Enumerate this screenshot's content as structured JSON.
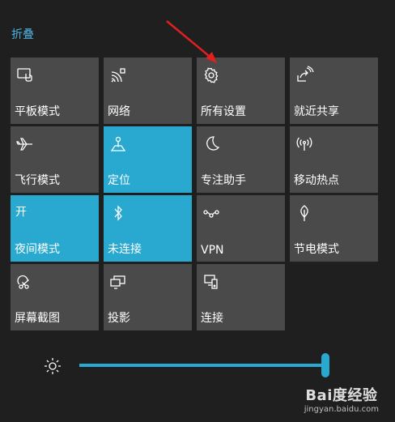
{
  "header": {
    "collapse_label": "折叠"
  },
  "tiles": [
    {
      "label": "平板模式",
      "icon": "tablet-mode-icon",
      "active": false
    },
    {
      "label": "网络",
      "icon": "network-icon",
      "active": false
    },
    {
      "label": "所有设置",
      "icon": "gear-icon",
      "active": false
    },
    {
      "label": "就近共享",
      "icon": "nearby-share-icon",
      "active": false
    },
    {
      "label": "飞行模式",
      "icon": "airplane-icon",
      "active": false
    },
    {
      "label": "定位",
      "icon": "location-icon",
      "active": true
    },
    {
      "label": "专注助手",
      "icon": "moon-icon",
      "active": false
    },
    {
      "label": "移动热点",
      "icon": "hotspot-icon",
      "active": false
    },
    {
      "label": "夜间模式",
      "state_text": "开",
      "active": true
    },
    {
      "label": "未连接",
      "icon": "bluetooth-icon",
      "active": true
    },
    {
      "label": "VPN",
      "icon": "vpn-icon",
      "active": false
    },
    {
      "label": "节电模式",
      "icon": "battery-saver-icon",
      "active": false
    },
    {
      "label": "屏幕截图",
      "icon": "screen-snip-icon",
      "active": false
    },
    {
      "label": "投影",
      "icon": "project-icon",
      "active": false
    },
    {
      "label": "连接",
      "icon": "connect-icon",
      "active": false
    }
  ],
  "brightness": {
    "icon": "sun-icon",
    "level": 1.0
  },
  "watermark": {
    "main": "Bai度经验",
    "sub": "jingyan.baidu.com"
  },
  "colors": {
    "background": "#1f1f1f",
    "tile": "#4a4a4a",
    "accent": "#2aa9d0",
    "link": "#4fb3e0",
    "annotation_arrow": "#e02020"
  }
}
